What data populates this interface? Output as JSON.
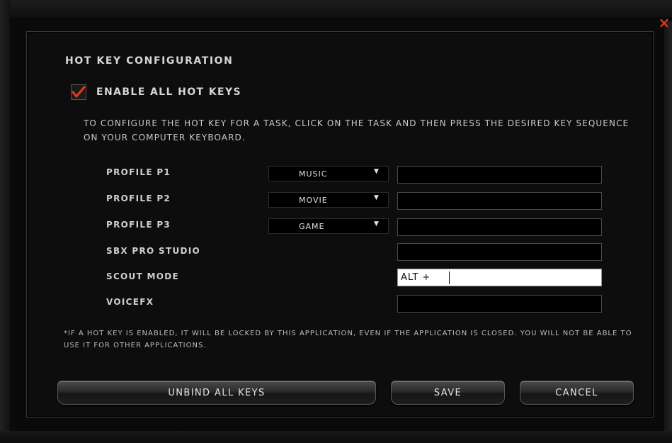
{
  "window": {
    "close_glyph": "×"
  },
  "dialog": {
    "title": "HOT KEY CONFIGURATION",
    "enable_all": {
      "label": "ENABLE ALL HOT KEYS",
      "checked": true,
      "check_color": "#d83a1e"
    },
    "instructions": "To configure the hot key for a task, click on the task and then press the desired key sequence on your computer keyboard.",
    "rows": [
      {
        "label": "PROFILE P1",
        "profile": "Music",
        "hotkey": ""
      },
      {
        "label": "PROFILE P2",
        "profile": "Movie",
        "hotkey": ""
      },
      {
        "label": "PROFILE P3",
        "profile": "Game",
        "hotkey": ""
      },
      {
        "label": "SBX PRO STUDIO",
        "hotkey": ""
      },
      {
        "label": "SCOUT MODE",
        "hotkey": "Alt +"
      },
      {
        "label": "VOICEFX",
        "hotkey": ""
      }
    ],
    "footnote": "*If a hot key is enabled, it will be locked by this application, even if the application is closed. You will not be able to use it for other applications.",
    "buttons": {
      "unbind_all": "Unbind All Keys",
      "save": "Save",
      "cancel": "Cancel"
    }
  },
  "colors": {
    "accent": "#d83a1e",
    "background": "#0d0d0d",
    "text": "#d6d6d6"
  }
}
